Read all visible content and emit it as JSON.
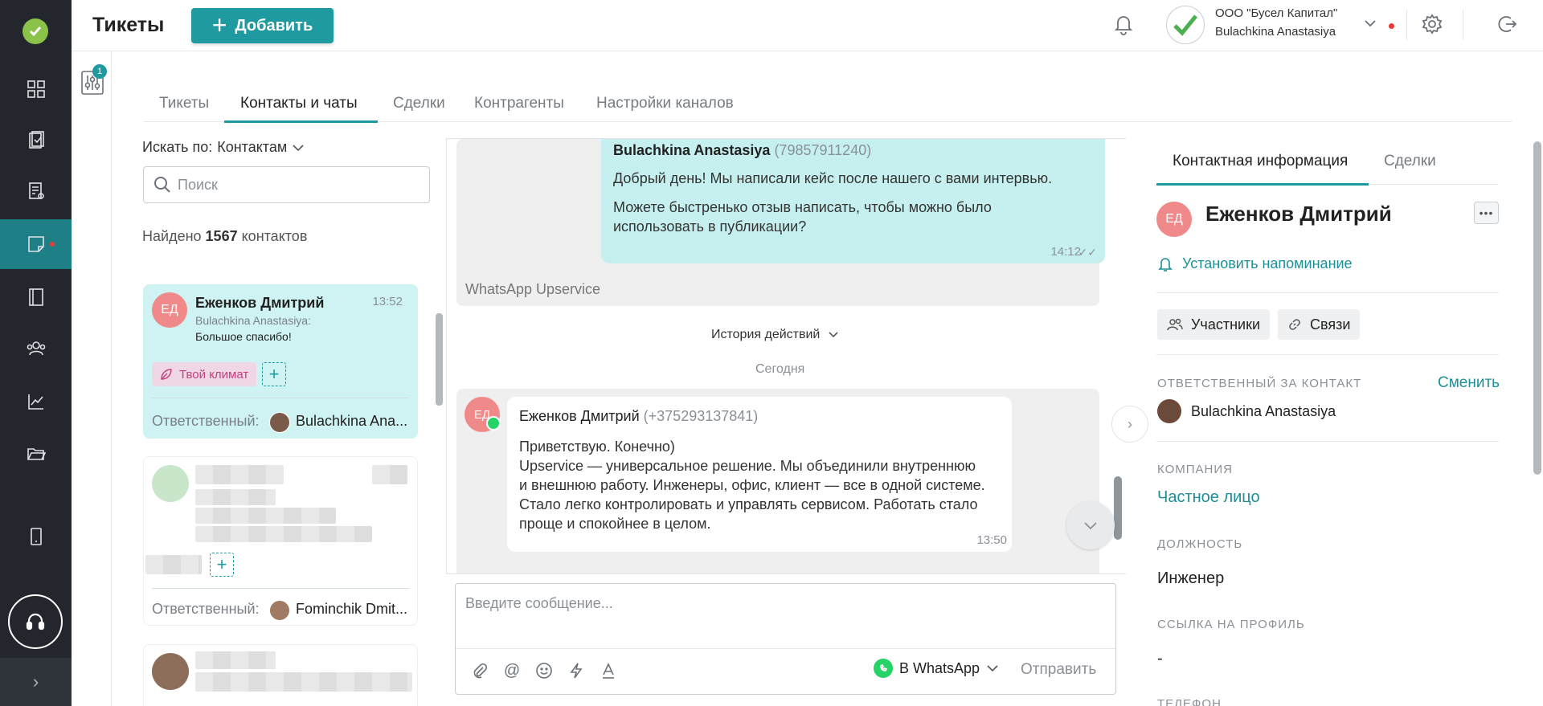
{
  "header": {
    "title": "Тикеты",
    "add_label": "Добавить",
    "org_name": "ООО \"Бусел Капитал\"",
    "user_name": "Bulachkina Anastasiya"
  },
  "filter": {
    "badge": "1"
  },
  "tabs": [
    {
      "label": "Тикеты",
      "active": false
    },
    {
      "label": "Контакты и чаты",
      "active": true
    },
    {
      "label": "Сделки",
      "active": false
    },
    {
      "label": "Контрагенты",
      "active": false
    },
    {
      "label": "Настройки каналов",
      "active": false
    }
  ],
  "contacts": {
    "search_by_label": "Искать по:",
    "search_by_value": "Контактам",
    "search_placeholder": "Поиск",
    "found_prefix": "Найдено",
    "found_count": "1567",
    "found_suffix": "контактов",
    "responsible_label": "Ответственный:",
    "items": [
      {
        "initials": "ЕД",
        "name": "Еженков Дмитрий",
        "time": "13:52",
        "last_sender": "Bulachkina Anastasiya:",
        "last_message": "Большое спасибо!",
        "tag": "Твой климат",
        "responsible": "Bulachkina Ana..."
      },
      {
        "responsible": "Fominchik Dmit..."
      }
    ]
  },
  "chat": {
    "outgoing": {
      "sender": "Bulachkina Anastasiya",
      "phone": "(79857911240)",
      "line1": "Добрый день! Мы написали кейс после нашего с вами интервью.",
      "line2": "Можете быстренько отзыв написать, чтобы можно было",
      "line3": "использовать в публикации?",
      "time": "14:12"
    },
    "channel_label": "WhatsApp Upservice",
    "history_label": "История действий",
    "date_separator": "Сегодня",
    "incoming": {
      "initials": "ЕД",
      "sender": "Еженков Дмитрий",
      "phone": "(+375293137841)",
      "line1": "Приветствую. Конечно)",
      "line2": "Upservice — универсальное решение. Мы объединили внутреннюю",
      "line3": "и внешнюю работу. Инженеры, офис, клиент — все в одной системе.",
      "line4": "Стало легко контролировать и управлять сервисом. Работать стало",
      "line5": "проще и спокойнее в целом.",
      "time": "13:50"
    },
    "composer_placeholder": "Введите сообщение...",
    "send_channel": "В WhatsApp",
    "send_label": "Отправить"
  },
  "contact_panel": {
    "tabs": [
      "Контактная информация",
      "Сделки"
    ],
    "initials": "ЕД",
    "name": "Еженков Дмитрий",
    "reminder": "Установить напоминание",
    "participants": "Участники",
    "links": "Связи",
    "responsible_label": "ОТВЕТСТВЕННЫЙ ЗА КОНТАКТ",
    "change_label": "Сменить",
    "responsible_name": "Bulachkina Anastasiya",
    "company_label": "КОМПАНИЯ",
    "company_value": "Частное лицо",
    "position_label": "ДОЛЖНОСТЬ",
    "position_value": "Инженер",
    "profile_label": "ССЫЛКА НА ПРОФИЛЬ",
    "profile_value": "-",
    "phone_label": "ТЕЛЕФОН"
  },
  "colors": {
    "accent": "#1f9aa0",
    "rail": "#23272d",
    "active_card": "#cff3f3",
    "outgoing_bubble": "#c6f0f0",
    "tag_bg": "#f0d7e6",
    "tag_text": "#c2407e"
  }
}
